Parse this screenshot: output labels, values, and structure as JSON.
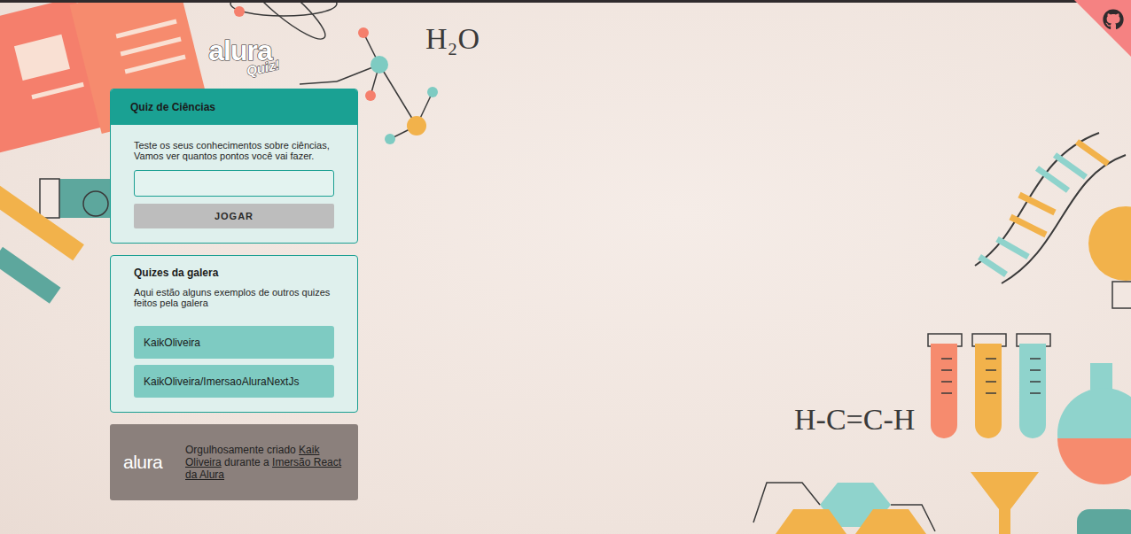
{
  "logo": {
    "name": "alura",
    "tag": "Quiz!"
  },
  "quiz": {
    "title": "Quiz de Ciências",
    "description": [
      "Teste os seus conhecimentos sobre ciências,",
      "Vamos ver quantos pontos você vai fazer."
    ],
    "input": {
      "value": ""
    },
    "button": {
      "label": "JOGAR",
      "disabled": true
    }
  },
  "gallery": {
    "title": "Quizes da galera",
    "description": "Aqui estão alguns exemplos de outros quizes feitos pela galera",
    "links": [
      "KaikOliveira",
      "KaikOliveira/ImersaoAluraNextJs"
    ]
  },
  "footer": {
    "logo": "alura",
    "parts": [
      {
        "text": "Orgulhosamente criado ",
        "link": false
      },
      {
        "text": "Kaik Oliveira",
        "link": true
      },
      {
        "text": " durante a ",
        "link": false
      },
      {
        "text": "Imersão React da Alura",
        "link": true
      }
    ]
  },
  "formulas": [
    "H₂O",
    "H-C=C-H"
  ]
}
